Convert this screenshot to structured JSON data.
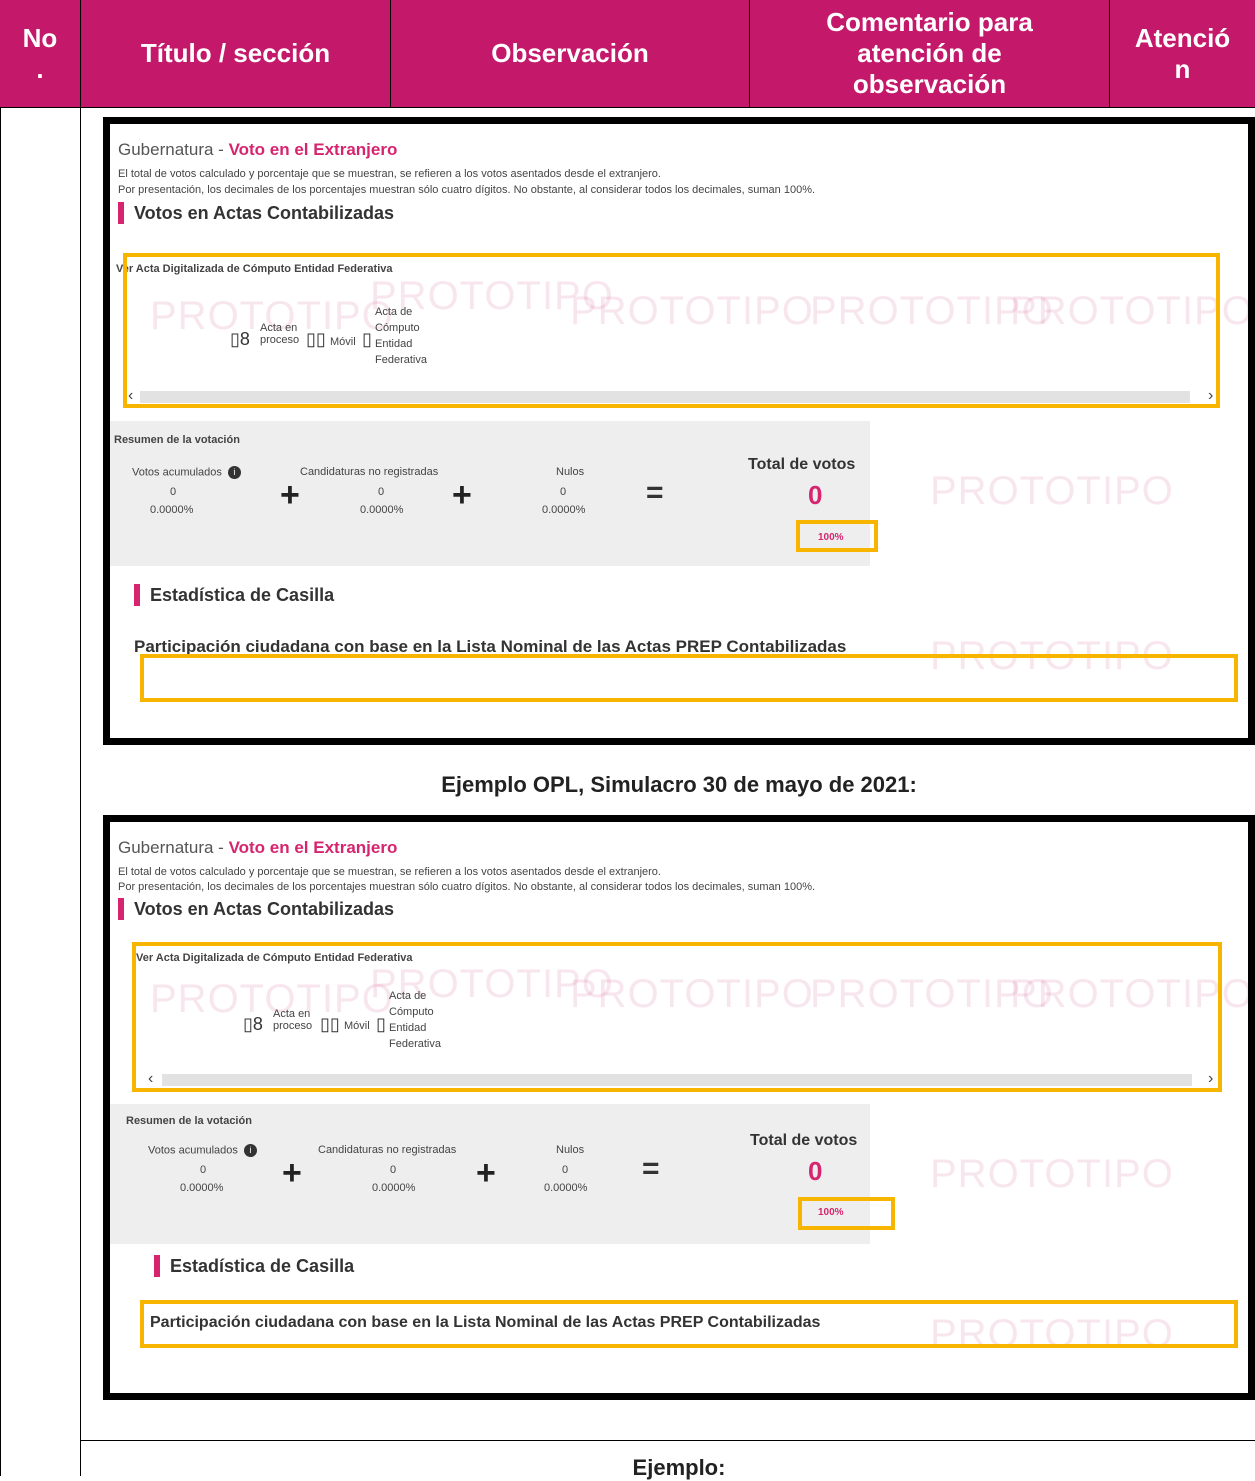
{
  "table": {
    "headers": [
      "No\n.",
      "Título / sección",
      "Observación",
      "Comentario para\natención de\nobservación",
      "Atenció\nn"
    ]
  },
  "screenshots": [
    {
      "title_prefix": "Gubernatura - ",
      "title_highlight": "Voto en el Extranjero",
      "note_1": "El total de votos calculado y porcentaje que se muestran, se refieren a los votos asentados desde el extranjero.",
      "note_2": "Por presentación, los decimales de los porcentajes muestran sólo cuatro dígitos. No obstante, al considerar todos los decimales, suman 100%.",
      "section_votos": "Votos en Actas Contabilizadas",
      "acta_link": "Ver Acta Digitalizada de Cómputo Entidad Federativa",
      "acta_en_proceso": "Acta en proceso",
      "movil": "Móvil",
      "acta_computo": "Acta de Cómputo Entidad Federativa",
      "resumen": "Resumen de la votación",
      "votos_acumulados": "Votos acumulados",
      "candidaturas_no_registradas": "Candidaturas no registradas",
      "nulos": "Nulos",
      "zero": "0",
      "pct_zero": "0.0000%",
      "total_label": "Total de votos",
      "total_value": "0",
      "total_pct": "100%",
      "estadistica": "Estadística de Casilla",
      "participacion": "Participación ciudadana con base en la Lista Nominal de las Actas PREP Contabilizadas",
      "watermark": "PROTOTIPO"
    }
  ],
  "captions": {
    "ejemplo_opl": "Ejemplo OPL, Simulacro 30 de mayo de 2021:",
    "ejemplo": "Ejemplo:"
  }
}
